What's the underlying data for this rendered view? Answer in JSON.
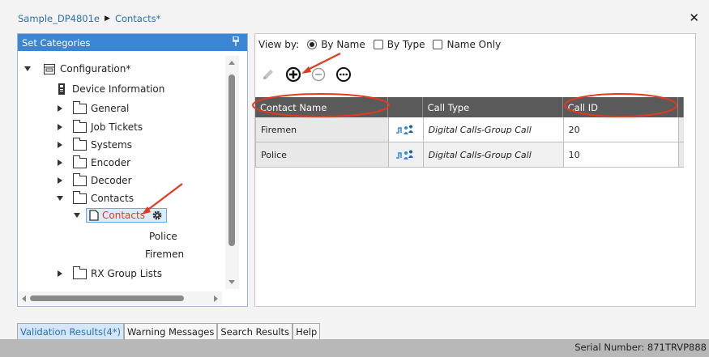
{
  "breadcrumb": {
    "root": "Sample_DP4801e",
    "current": "Contacts*"
  },
  "left_panel": {
    "title": "Set Categories",
    "tree": {
      "configuration": "Configuration*",
      "device_information": "Device Information",
      "general": "General",
      "job_tickets": "Job Tickets",
      "systems": "Systems",
      "encoder": "Encoder",
      "decoder": "Decoder",
      "contacts_folder": "Contacts",
      "contacts_node": "Contacts",
      "police": "Police",
      "firemen": "Firemen",
      "rx_group_lists": "RX Group Lists"
    }
  },
  "view_by": {
    "label": "View by:",
    "options": [
      "By Name",
      "By Type",
      "Name Only"
    ],
    "selected": "By Name"
  },
  "grid": {
    "columns": [
      "Contact Name",
      "",
      "Call Type",
      "Call ID",
      ""
    ],
    "rows": [
      {
        "name": "Firemen",
        "call_type": "Digital Calls-Group Call",
        "call_id": "20"
      },
      {
        "name": "Police",
        "call_type": "Digital Calls-Group Call",
        "call_id": "10"
      }
    ]
  },
  "tabs": [
    "Validation Results(4*)",
    "Warning Messages",
    "Search Results",
    "Help"
  ],
  "status": {
    "serial": "Serial Number: 871TRVP888"
  },
  "colors": {
    "header_blue": "#3b85d5",
    "grid_header": "#5a5a5a",
    "annotation_red": "#e2391f",
    "link_blue": "#2a6fb0"
  }
}
